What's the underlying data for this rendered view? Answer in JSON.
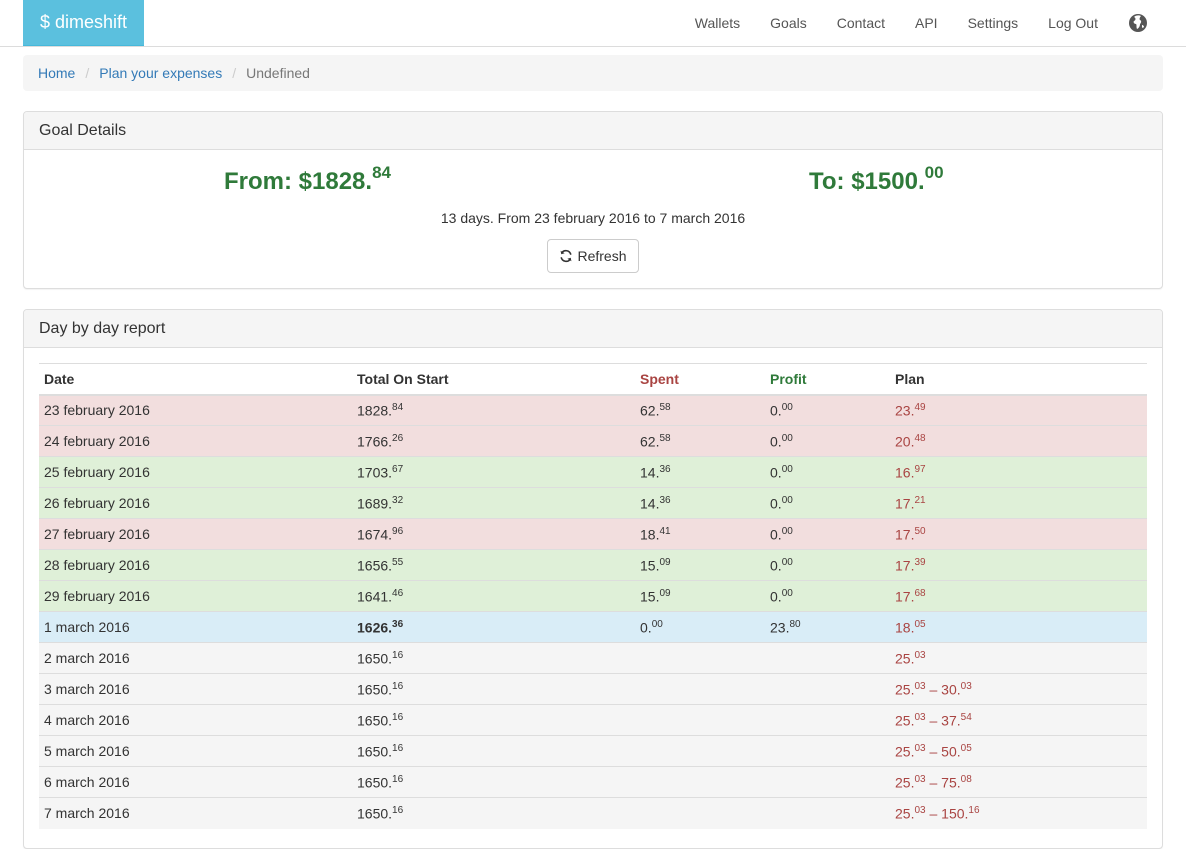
{
  "brand": "$ dimeshift",
  "nav": [
    "Wallets",
    "Goals",
    "Contact",
    "API",
    "Settings",
    "Log Out"
  ],
  "breadcrumb": {
    "home": "Home",
    "plan": "Plan your expenses",
    "current": "Undefined",
    "sep": "/"
  },
  "goal": {
    "heading": "Goal Details",
    "from_label": "From: $1828.",
    "from_cents": "84",
    "to_label": "To: $1500.",
    "to_cents": "00",
    "period": "13 days. From 23 february 2016 to 7 march 2016",
    "refresh": "Refresh"
  },
  "report": {
    "heading": "Day by day report",
    "headers": {
      "date": "Date",
      "total": "Total On Start",
      "spent": "Spent",
      "profit": "Profit",
      "plan": "Plan"
    },
    "rows": [
      {
        "status": "danger",
        "date": "23 february 2016",
        "total": [
          "1828.",
          "84"
        ],
        "spent": [
          "62.",
          "58"
        ],
        "profit": [
          "0.",
          "00"
        ],
        "plan": [
          "23.",
          "49"
        ]
      },
      {
        "status": "danger",
        "date": "24 february 2016",
        "total": [
          "1766.",
          "26"
        ],
        "spent": [
          "62.",
          "58"
        ],
        "profit": [
          "0.",
          "00"
        ],
        "plan": [
          "20.",
          "48"
        ]
      },
      {
        "status": "success",
        "date": "25 february 2016",
        "total": [
          "1703.",
          "67"
        ],
        "spent": [
          "14.",
          "36"
        ],
        "profit": [
          "0.",
          "00"
        ],
        "plan": [
          "16.",
          "97"
        ]
      },
      {
        "status": "success",
        "date": "26 february 2016",
        "total": [
          "1689.",
          "32"
        ],
        "spent": [
          "14.",
          "36"
        ],
        "profit": [
          "0.",
          "00"
        ],
        "plan": [
          "17.",
          "21"
        ]
      },
      {
        "status": "danger",
        "date": "27 february 2016",
        "total": [
          "1674.",
          "96"
        ],
        "spent": [
          "18.",
          "41"
        ],
        "profit": [
          "0.",
          "00"
        ],
        "plan": [
          "17.",
          "50"
        ]
      },
      {
        "status": "success",
        "date": "28 february 2016",
        "total": [
          "1656.",
          "55"
        ],
        "spent": [
          "15.",
          "09"
        ],
        "profit": [
          "0.",
          "00"
        ],
        "plan": [
          "17.",
          "39"
        ]
      },
      {
        "status": "success",
        "date": "29 february 2016",
        "total": [
          "1641.",
          "46"
        ],
        "spent": [
          "15.",
          "09"
        ],
        "profit": [
          "0.",
          "00"
        ],
        "plan": [
          "17.",
          "68"
        ]
      },
      {
        "status": "info",
        "date": "1 march 2016",
        "total": [
          "1626.",
          "36"
        ],
        "total_bold": true,
        "spent": [
          "0.",
          "00"
        ],
        "profit": [
          "23.",
          "80"
        ],
        "plan": [
          "18.",
          "05"
        ]
      },
      {
        "status": "future",
        "date": "2 march 2016",
        "total": [
          "1650.",
          "16"
        ],
        "plan": [
          "25.",
          "03"
        ]
      },
      {
        "status": "future",
        "date": "3 march 2016",
        "total": [
          "1650.",
          "16"
        ],
        "plan": [
          "25.",
          "03"
        ],
        "plan_max": [
          "30.",
          "03"
        ]
      },
      {
        "status": "future",
        "date": "4 march 2016",
        "total": [
          "1650.",
          "16"
        ],
        "plan": [
          "25.",
          "03"
        ],
        "plan_max": [
          "37.",
          "54"
        ]
      },
      {
        "status": "future",
        "date": "5 march 2016",
        "total": [
          "1650.",
          "16"
        ],
        "plan": [
          "25.",
          "03"
        ],
        "plan_max": [
          "50.",
          "05"
        ]
      },
      {
        "status": "future",
        "date": "6 march 2016",
        "total": [
          "1650.",
          "16"
        ],
        "plan": [
          "25.",
          "03"
        ],
        "plan_max": [
          "75.",
          "08"
        ]
      },
      {
        "status": "future",
        "date": "7 march 2016",
        "total": [
          "1650.",
          "16"
        ],
        "plan": [
          "25.",
          "03"
        ],
        "plan_max": [
          "150.",
          "16"
        ]
      }
    ],
    "range_sep": " – "
  },
  "colors": {
    "brand": "#5bc0de",
    "green": "#2f7a3a",
    "red": "#a94442",
    "link": "#337ab7"
  },
  "icons": {
    "globe": "globe-icon",
    "refresh": "refresh-icon"
  }
}
